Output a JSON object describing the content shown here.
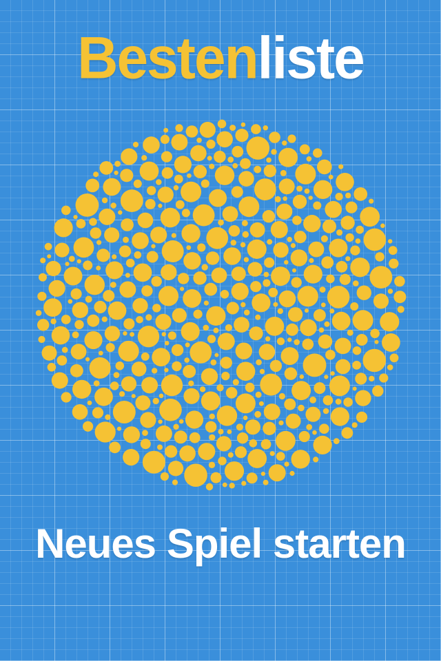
{
  "menu": {
    "highscore": {
      "part_a": "Besten",
      "part_b": "liste"
    },
    "new_game_label": "Neues Spiel starten"
  },
  "colors": {
    "background": "#3a8fdb",
    "accent_yellow": "#f5c234",
    "text_white": "#ffffff"
  },
  "illustration": {
    "type": "dot-pattern-circle",
    "dot_color": "#f5c234"
  }
}
